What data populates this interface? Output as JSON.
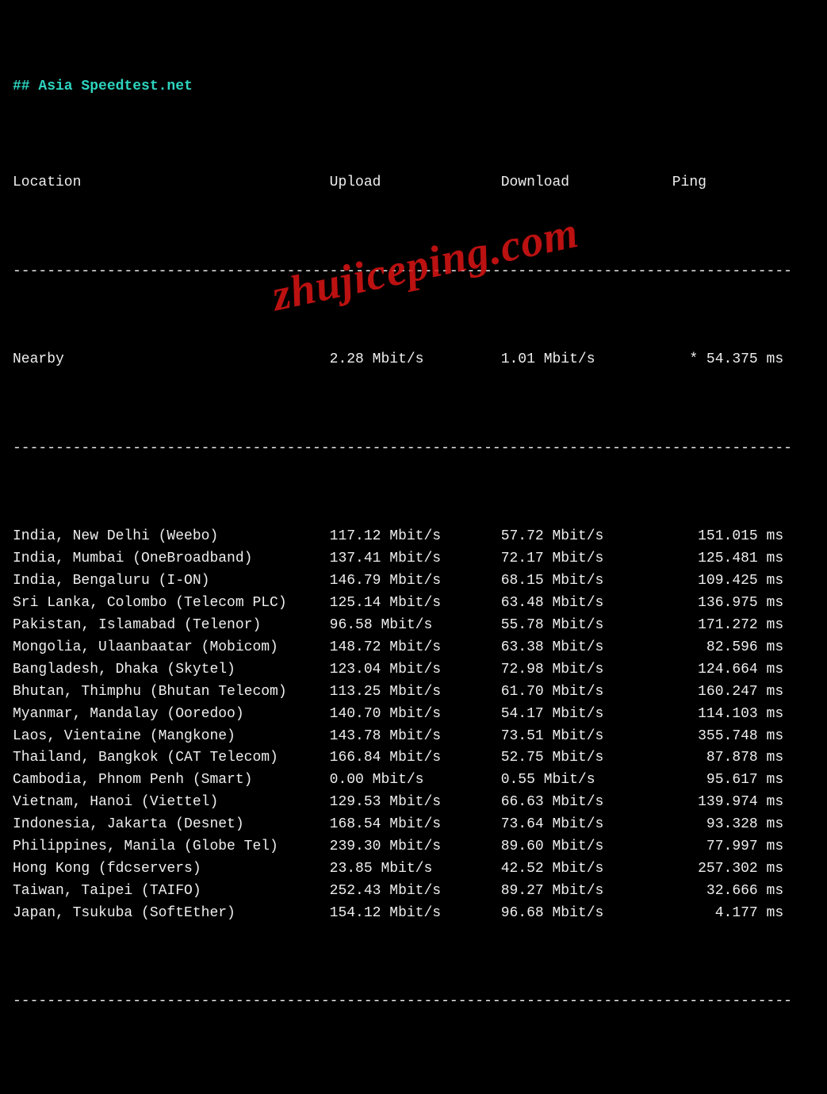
{
  "title": "## Asia Speedtest.net",
  "headers": {
    "location": "Location",
    "upload": "Upload",
    "download": "Download",
    "ping": "Ping"
  },
  "divider": "-------------------------------------------------------------------------------------------",
  "nearby": {
    "location": "Nearby",
    "upload": "2.28 Mbit/s",
    "download": "1.01 Mbit/s",
    "ping": "* 54.375 ms"
  },
  "rows": [
    {
      "location": "India, New Delhi (Weebo)",
      "upload": "117.12 Mbit/s",
      "download": "57.72 Mbit/s",
      "ping": "151.015 ms"
    },
    {
      "location": "India, Mumbai (OneBroadband)",
      "upload": "137.41 Mbit/s",
      "download": "72.17 Mbit/s",
      "ping": "125.481 ms"
    },
    {
      "location": "India, Bengaluru (I-ON)",
      "upload": "146.79 Mbit/s",
      "download": "68.15 Mbit/s",
      "ping": "109.425 ms"
    },
    {
      "location": "Sri Lanka, Colombo (Telecom PLC)",
      "upload": "125.14 Mbit/s",
      "download": "63.48 Mbit/s",
      "ping": "136.975 ms"
    },
    {
      "location": "Pakistan, Islamabad (Telenor)",
      "upload": "96.58 Mbit/s",
      "download": "55.78 Mbit/s",
      "ping": "171.272 ms"
    },
    {
      "location": "Mongolia, Ulaanbaatar (Mobicom)",
      "upload": "148.72 Mbit/s",
      "download": "63.38 Mbit/s",
      "ping": "82.596 ms"
    },
    {
      "location": "Bangladesh, Dhaka (Skytel)",
      "upload": "123.04 Mbit/s",
      "download": "72.98 Mbit/s",
      "ping": "124.664 ms"
    },
    {
      "location": "Bhutan, Thimphu (Bhutan Telecom)",
      "upload": "113.25 Mbit/s",
      "download": "61.70 Mbit/s",
      "ping": "160.247 ms"
    },
    {
      "location": "Myanmar, Mandalay (Ooredoo)",
      "upload": "140.70 Mbit/s",
      "download": "54.17 Mbit/s",
      "ping": "114.103 ms"
    },
    {
      "location": "Laos, Vientaine (Mangkone)",
      "upload": "143.78 Mbit/s",
      "download": "73.51 Mbit/s",
      "ping": "355.748 ms"
    },
    {
      "location": "Thailand, Bangkok (CAT Telecom)",
      "upload": "166.84 Mbit/s",
      "download": "52.75 Mbit/s",
      "ping": "87.878 ms"
    },
    {
      "location": "Cambodia, Phnom Penh (Smart)",
      "upload": "0.00 Mbit/s",
      "download": "0.55 Mbit/s",
      "ping": "95.617 ms"
    },
    {
      "location": "Vietnam, Hanoi (Viettel)",
      "upload": "129.53 Mbit/s",
      "download": "66.63 Mbit/s",
      "ping": "139.974 ms"
    },
    {
      "location": "Indonesia, Jakarta (Desnet)",
      "upload": "168.54 Mbit/s",
      "download": "73.64 Mbit/s",
      "ping": "93.328 ms"
    },
    {
      "location": "Philippines, Manila (Globe Tel)",
      "upload": "239.30 Mbit/s",
      "download": "89.60 Mbit/s",
      "ping": "77.997 ms"
    },
    {
      "location": "Hong Kong (fdcservers)",
      "upload": "23.85 Mbit/s",
      "download": "42.52 Mbit/s",
      "ping": "257.302 ms"
    },
    {
      "location": "Taiwan, Taipei (TAIFO)",
      "upload": "252.43 Mbit/s",
      "download": "89.27 Mbit/s",
      "ping": "32.666 ms"
    },
    {
      "location": "Japan, Tsukuba (SoftEther)",
      "upload": "154.12 Mbit/s",
      "download": "96.68 Mbit/s",
      "ping": "4.177 ms"
    }
  ],
  "watermark": "zhujiceping.com"
}
